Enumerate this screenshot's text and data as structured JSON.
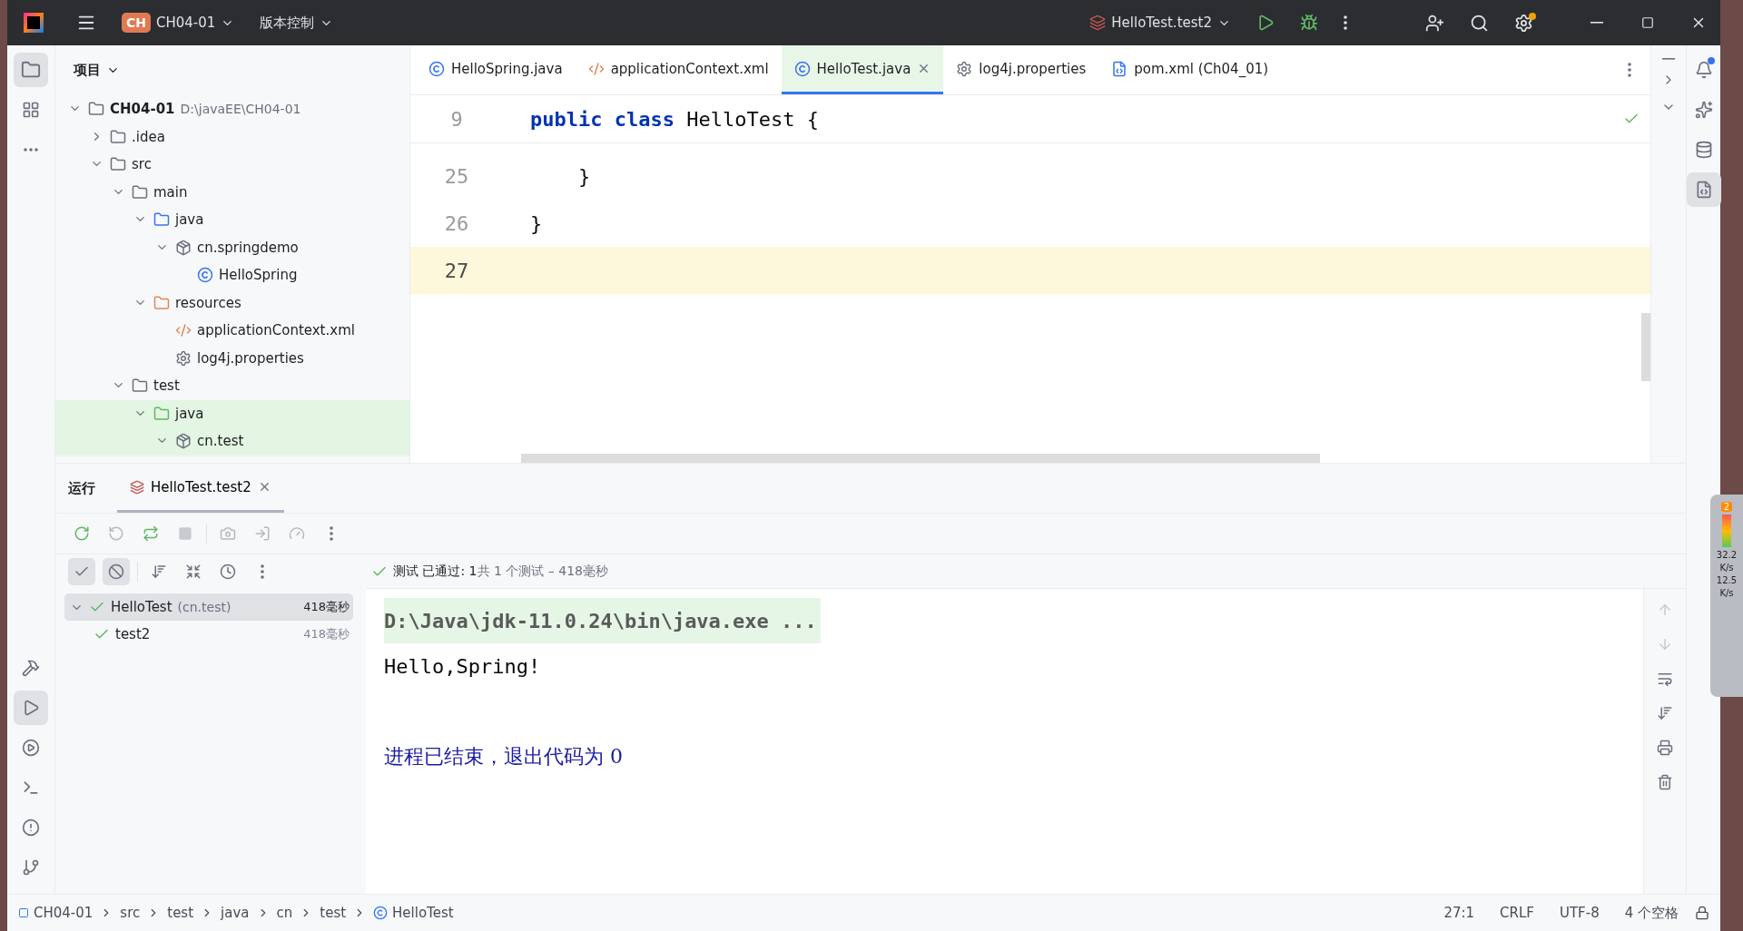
{
  "title_bar": {
    "project_badge": "CH",
    "project": "CH04-01",
    "vcs": "版本控制",
    "run_config": "HelloTest.test2"
  },
  "project_panel": {
    "title": "项目",
    "tree": [
      {
        "name": "CH04-01",
        "path": "D:\\javaEE\\CH04-01",
        "kind": "module",
        "expanded": true,
        "highlighted": false,
        "children": [
          {
            "name": ".idea",
            "kind": "folder",
            "expanded": false,
            "highlighted": false
          },
          {
            "name": "src",
            "kind": "folder",
            "expanded": true,
            "highlighted": false,
            "children": [
              {
                "name": "main",
                "kind": "folder",
                "expanded": true,
                "highlighted": false,
                "children": [
                  {
                    "name": "java",
                    "kind": "source",
                    "expanded": true,
                    "highlighted": false,
                    "children": [
                      {
                        "name": "cn.springdemo",
                        "kind": "package",
                        "expanded": true,
                        "highlighted": false,
                        "children": [
                          {
                            "name": "HelloSpring",
                            "kind": "class",
                            "highlighted": false
                          }
                        ]
                      }
                    ]
                  },
                  {
                    "name": "resources",
                    "kind": "resources",
                    "expanded": true,
                    "highlighted": false,
                    "children": [
                      {
                        "name": "applicationContext.xml",
                        "kind": "xml",
                        "highlighted": false
                      },
                      {
                        "name": "log4j.properties",
                        "kind": "properties",
                        "highlighted": false
                      }
                    ]
                  }
                ]
              },
              {
                "name": "test",
                "kind": "folder",
                "expanded": true,
                "highlighted": false,
                "children": [
                  {
                    "name": "java",
                    "kind": "test-source",
                    "expanded": true,
                    "highlighted": true,
                    "children": [
                      {
                        "name": "cn.test",
                        "kind": "package",
                        "expanded": true,
                        "highlighted": true
                      }
                    ]
                  }
                ]
              }
            ]
          }
        ]
      }
    ]
  },
  "editor": {
    "tabs": [
      {
        "label": "HelloSpring.java",
        "kind": "class",
        "selected": false,
        "closable": false
      },
      {
        "label": "applicationContext.xml",
        "kind": "xml",
        "selected": false,
        "closable": false
      },
      {
        "label": "HelloTest.java",
        "kind": "test-class",
        "selected": true,
        "closable": true
      },
      {
        "label": "log4j.properties",
        "kind": "properties",
        "selected": false,
        "closable": false
      },
      {
        "label": "pom.xml (Ch04_01)",
        "kind": "maven",
        "selected": false,
        "closable": false
      }
    ],
    "sticky_line": {
      "number": "9",
      "code": "**public class** HelloTest {"
    },
    "lines": [
      {
        "number": "25",
        "code": "    }",
        "current": false
      },
      {
        "number": "26",
        "code": "}",
        "current": false
      },
      {
        "number": "27",
        "current": true
      }
    ]
  },
  "run_panel": {
    "title": "运行",
    "tab": "HelloTest.test2",
    "status": {
      "passed": "测试 已通过: 1",
      "summary": "共 1 个测试 – 418毫秒"
    },
    "tests": [
      {
        "name": "HelloTest",
        "package": "(cn.test)",
        "time": "418毫秒",
        "selected": true,
        "children": [
          {
            "name": "test2",
            "time": "418毫秒",
            "selected": false
          }
        ]
      }
    ],
    "console": [
      {
        "kind": "command",
        "text": "D:\\Java\\jdk-11.0.24\\bin\\java.exe ..."
      },
      {
        "kind": "output",
        "text": "Hello,Spring!"
      },
      {
        "kind": "system",
        "text": "进程已结束，退出代码为 0"
      }
    ]
  },
  "status_bar": {
    "breadcrumbs": [
      "CH04-01",
      "src",
      "test",
      "java",
      "cn",
      "test",
      "HelloTest"
    ],
    "position": "27:1",
    "line_ending": "CRLF",
    "encoding": "UTF-8",
    "indent": "4 个空格"
  },
  "speed_widget": {
    "badge": "2",
    "upload": "32.2",
    "upload_unit": "K/s",
    "download": "12.5",
    "download_unit": "K/s"
  }
}
